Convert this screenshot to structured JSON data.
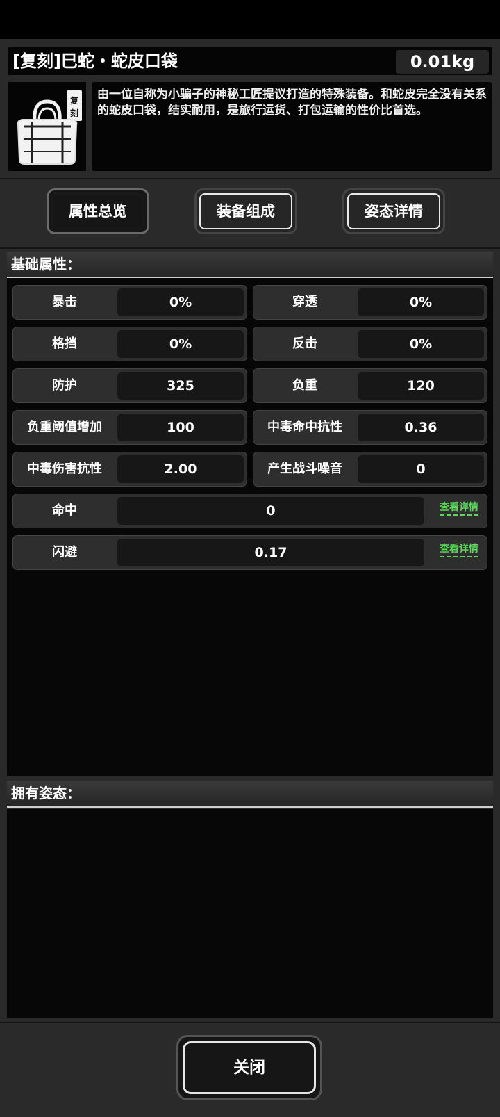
{
  "item": {
    "title": "[复刻]巳蛇・蛇皮口袋",
    "weight": "0.01kg",
    "badge": "复刻",
    "icon": "bag-icon",
    "description": "由一位自称为小骗子的神秘工匠提议打造的特殊装备。和蛇皮完全没有关系的蛇皮口袋，结实耐用，是旅行运货、打包运输的性价比首选。"
  },
  "tabs": [
    {
      "label": "属性总览",
      "active": true
    },
    {
      "label": "装备组成",
      "active": false
    },
    {
      "label": "姿态详情",
      "active": false
    }
  ],
  "sections": {
    "basic": "基础属性：",
    "postures": "拥有姿态："
  },
  "attributes": [
    {
      "label": "暴击",
      "value": "0%"
    },
    {
      "label": "穿透",
      "value": "0%"
    },
    {
      "label": "格挡",
      "value": "0%"
    },
    {
      "label": "反击",
      "value": "0%"
    },
    {
      "label": "防护",
      "value": "325"
    },
    {
      "label": "负重",
      "value": "120"
    },
    {
      "label": "负重阈值增加",
      "value": "100"
    },
    {
      "label": "中毒命中抗性",
      "value": "0.36"
    },
    {
      "label": "中毒伤害抗性",
      "value": "2.00"
    },
    {
      "label": "产生战斗噪音",
      "value": "0"
    }
  ],
  "wide_attributes": [
    {
      "label": "命中",
      "value": "0",
      "link": "查看详情"
    },
    {
      "label": "闪避",
      "value": "0.17",
      "link": "查看详情"
    }
  ],
  "close_label": "关闭",
  "colors": {
    "link": "#5bd85b",
    "panel": "#2a2a2a"
  }
}
